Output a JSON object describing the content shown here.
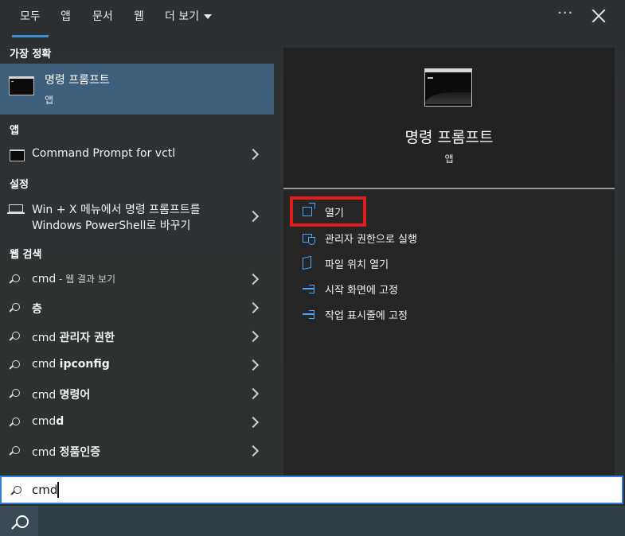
{
  "tabs": [
    {
      "label": "모두"
    },
    {
      "label": "앱"
    },
    {
      "label": "문서"
    },
    {
      "label": "웹"
    },
    {
      "label": "더 보기"
    }
  ],
  "header": {
    "more_icon": "ellipsis-icon",
    "close_icon": "close-icon"
  },
  "best_match": {
    "header": "가장 정확",
    "title": "명령 프롬프트",
    "subtitle": "앱"
  },
  "apps": {
    "header": "앱",
    "items": [
      {
        "label": "Command Prompt for vctl"
      }
    ]
  },
  "settings": {
    "header": "설정",
    "items": [
      {
        "line1": "Win + X 메뉴에서 명령 프롬프트를",
        "line2": "Windows PowerShell로 바꾸기"
      }
    ]
  },
  "web": {
    "header": "웹 검색",
    "items": [
      {
        "plain": "cmd",
        "suffix": " - 웹 결과 보기",
        "bold": ""
      },
      {
        "plain": "",
        "suffix": "",
        "bold": "층"
      },
      {
        "plain": "cmd ",
        "suffix": "",
        "bold": "관리자 권한"
      },
      {
        "plain": "cmd ",
        "suffix": "",
        "bold": "ipconfig"
      },
      {
        "plain": "cmd ",
        "suffix": "",
        "bold": "명령어"
      },
      {
        "plain": "cmd",
        "suffix": "",
        "bold": "d"
      },
      {
        "plain": "cmd ",
        "suffix": "",
        "bold": "정품인증"
      }
    ]
  },
  "preview": {
    "title": "명령 프롬프트",
    "subtitle": "앱",
    "actions": [
      {
        "label": "열기",
        "icon": "open-icon"
      },
      {
        "label": "관리자 권한으로 실행",
        "icon": "admin-shield-icon"
      },
      {
        "label": "파일 위치 열기",
        "icon": "folder-icon"
      },
      {
        "label": "시작 화면에 고정",
        "icon": "pin-icon"
      },
      {
        "label": "작업 표시줄에 고정",
        "icon": "pin-icon"
      }
    ]
  },
  "search": {
    "value": "cmd"
  },
  "colors": {
    "accent": "#3a8fd6",
    "selection": "#3d5f7b",
    "highlight_box": "#e21c1c"
  }
}
